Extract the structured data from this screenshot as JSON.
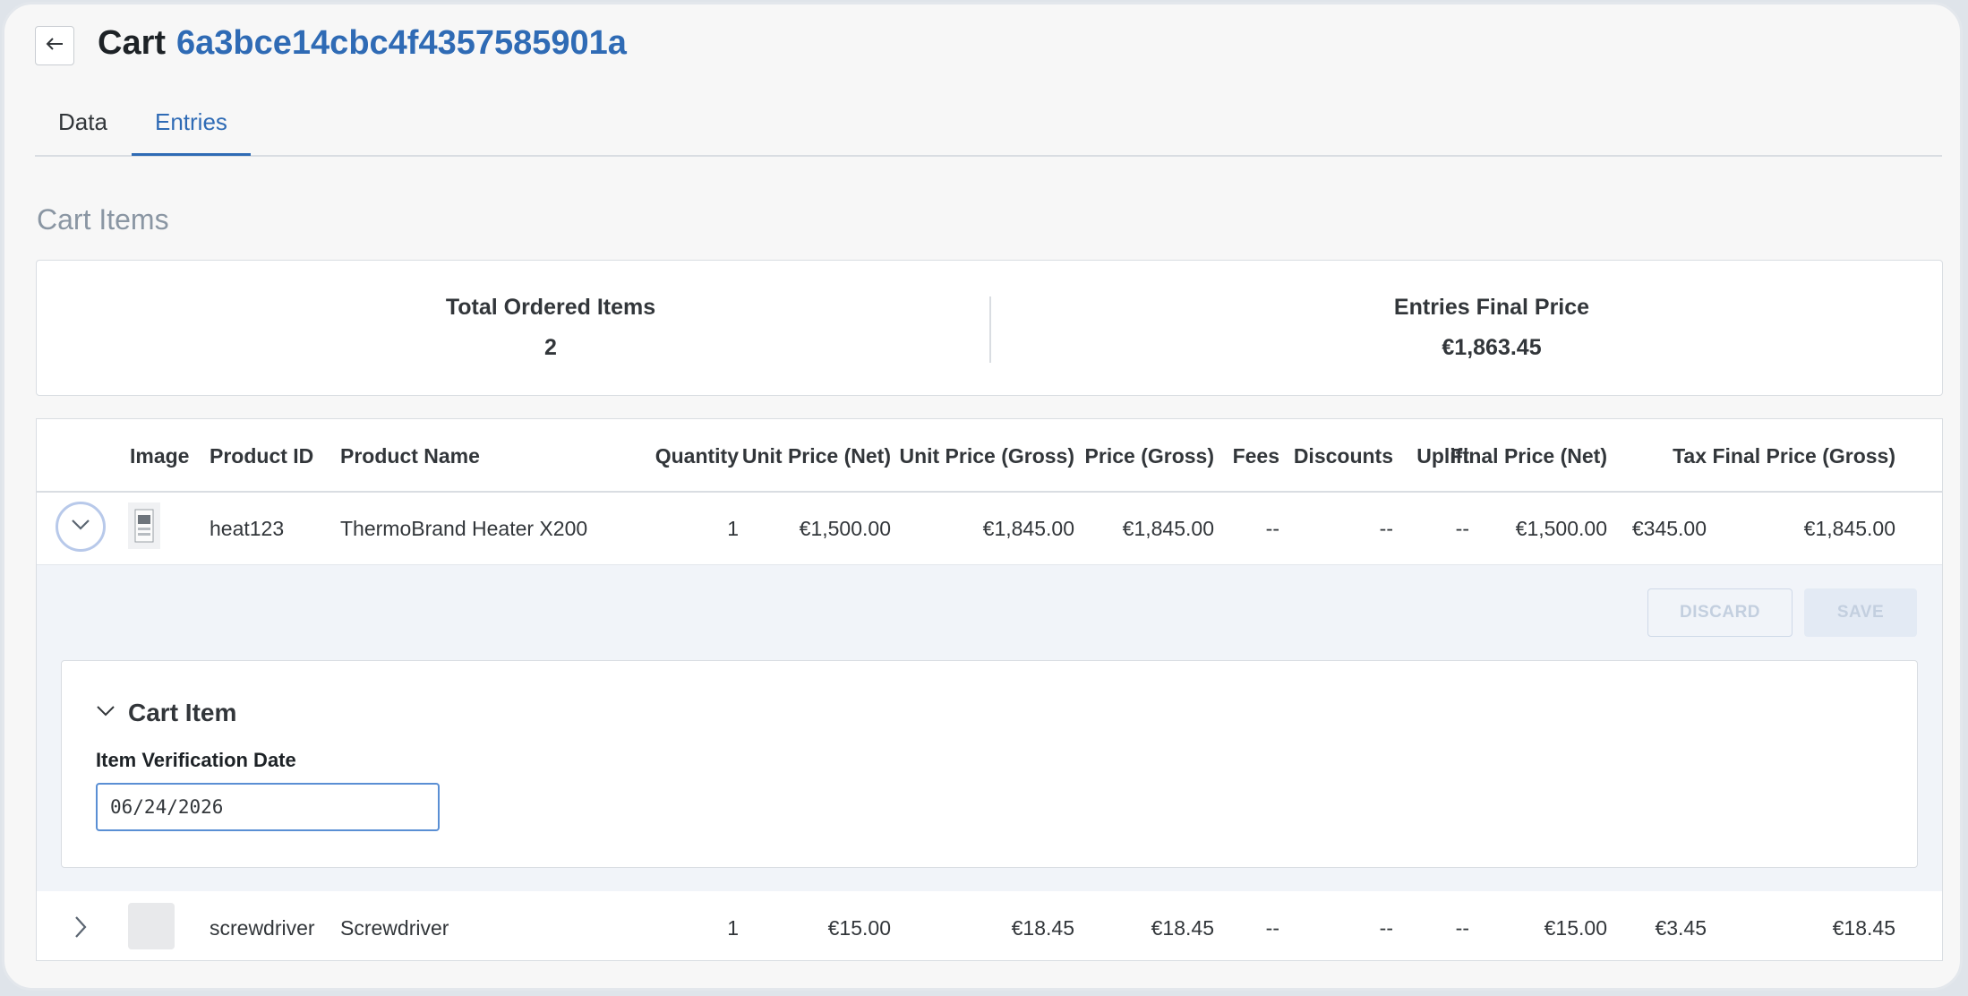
{
  "header": {
    "title": "Cart",
    "cart_id": "6a3bce14cbc4f4357585901a"
  },
  "tabs": [
    {
      "label": "Data",
      "active": false
    },
    {
      "label": "Entries",
      "active": true
    }
  ],
  "section_title": "Cart Items",
  "summary": {
    "total_ordered_items_label": "Total Ordered Items",
    "total_ordered_items": "2",
    "entries_final_price_label": "Entries Final Price",
    "entries_final_price": "€1,863.45"
  },
  "table": {
    "columns": [
      "Image",
      "Product ID",
      "Product Name",
      "Quantity",
      "Unit Price (Net)",
      "Unit Price (Gross)",
      "Price (Gross)",
      "Fees",
      "Discounts",
      "Uplift",
      "Final Price (Net)",
      "Tax",
      "Final Price (Gross)"
    ],
    "rows": [
      {
        "expanded": true,
        "product_id": "heat123",
        "product_name": "ThermoBrand Heater X200",
        "quantity": "1",
        "unit_price_net": "€1,500.00",
        "unit_price_gross": "€1,845.00",
        "price_gross": "€1,845.00",
        "fees": "--",
        "discounts": "--",
        "uplift": "--",
        "final_price_net": "€1,500.00",
        "tax": "€345.00",
        "final_price_gross": "€1,845.00"
      },
      {
        "expanded": false,
        "product_id": "screwdriver",
        "product_name": "Screwdriver",
        "quantity": "1",
        "unit_price_net": "€15.00",
        "unit_price_gross": "€18.45",
        "price_gross": "€18.45",
        "fees": "--",
        "discounts": "--",
        "uplift": "--",
        "final_price_net": "€15.00",
        "tax": "€3.45",
        "final_price_gross": "€18.45"
      }
    ]
  },
  "editor": {
    "discard_label": "DISCARD",
    "save_label": "SAVE",
    "panel_title": "Cart Item",
    "field_label": "Item Verification Date",
    "field_value": "06/24/2026"
  },
  "icons": {
    "back": "arrow-left-icon",
    "expand": "chevron-down-icon",
    "collapse": "chevron-right-icon"
  },
  "colors": {
    "accent": "#2f6bb5",
    "muted": "#8a96a3"
  }
}
